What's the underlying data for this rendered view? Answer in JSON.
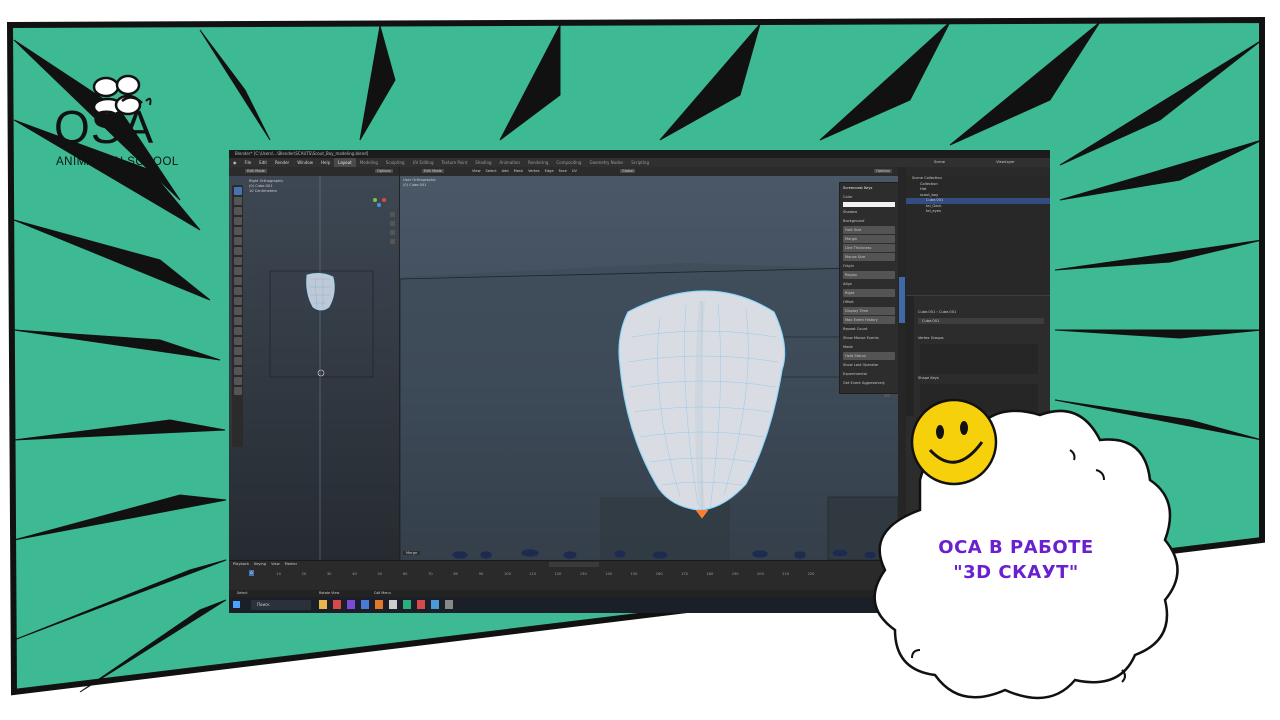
{
  "logo": {
    "name": "OSA",
    "subtitle": "ANIMATION SCHOOL"
  },
  "blender": {
    "title": "Blender* [C:\\Users\\...\\Blender\\SCAUTS\\Scout_Boy_modeling.blend]",
    "menu": [
      "File",
      "Edit",
      "Render",
      "Window",
      "Help"
    ],
    "workspaces": [
      "Layout",
      "Modeling",
      "Sculpting",
      "UV Editing",
      "Texture Paint",
      "Shading",
      "Animation",
      "Rendering",
      "Compositing",
      "Geometry Nodes",
      "Scripting"
    ],
    "active_workspace": "Layout",
    "left_viewport": {
      "mode": "Edit Mode",
      "info": [
        "Right Orthographic",
        "(0) Cube.001",
        "10 Centimeters"
      ],
      "options": "Options"
    },
    "main_viewport": {
      "mode": "Edit Mode",
      "info": [
        "User Orthographic",
        "(0) Cube.001"
      ],
      "menu": [
        "View",
        "Select",
        "Add",
        "Mesh",
        "Vertex",
        "Edge",
        "Face",
        "UV"
      ],
      "transform": "Global",
      "options": "Options",
      "status_label": "Merge"
    },
    "npanel": {
      "title": "Screencast Keys",
      "rows": [
        "Color",
        "Shadow",
        "Background",
        "Font Size",
        "Margin",
        "Line Thickness",
        "Mouse Size",
        "Origin",
        "Align",
        "Offset",
        "Display Time",
        "Max Event History",
        "Repeat Count",
        "Show Mouse Events",
        "Mode",
        "Show Last Operator",
        "Experimental",
        "Get Event Aggressively"
      ],
      "origin_value": "Region",
      "align_value": "Right",
      "mode_value": "Hold Status"
    },
    "outliner": {
      "scene": "Scene",
      "view_layer": "ViewLayer",
      "rows": [
        "Scene Collection",
        "Collection",
        "Hat",
        "scout_boy",
        "Cube.001",
        "tel_Geck",
        "tel_eyes"
      ],
      "selected": "Cube.001"
    },
    "properties": {
      "object": "Cube.001",
      "mesh": "Cube.001",
      "sections": [
        "Vertex Groups",
        "Shape Keys"
      ]
    },
    "timeline": {
      "menu": [
        "Playback",
        "Keying",
        "View",
        "Marker"
      ],
      "current_frame": "0",
      "ticks": [
        "0",
        "10",
        "20",
        "30",
        "40",
        "50",
        "60",
        "70",
        "80",
        "90",
        "100",
        "110",
        "120",
        "130",
        "140",
        "150",
        "160",
        "170",
        "180",
        "190",
        "200",
        "210",
        "220"
      ]
    },
    "status": [
      "Select",
      "Rotate View",
      "Call Menu"
    ],
    "taskbar": {
      "search": "Поиск"
    }
  },
  "cloud": {
    "line1": "ОСА В РАБОТЕ",
    "line2": "\"3D СКАУТ\""
  },
  "colors": {
    "background_green": "#3dba93",
    "accent_purple": "#6a1fd0",
    "smiley_yellow": "#f6d10b",
    "blender_selection": "#4772b3"
  }
}
